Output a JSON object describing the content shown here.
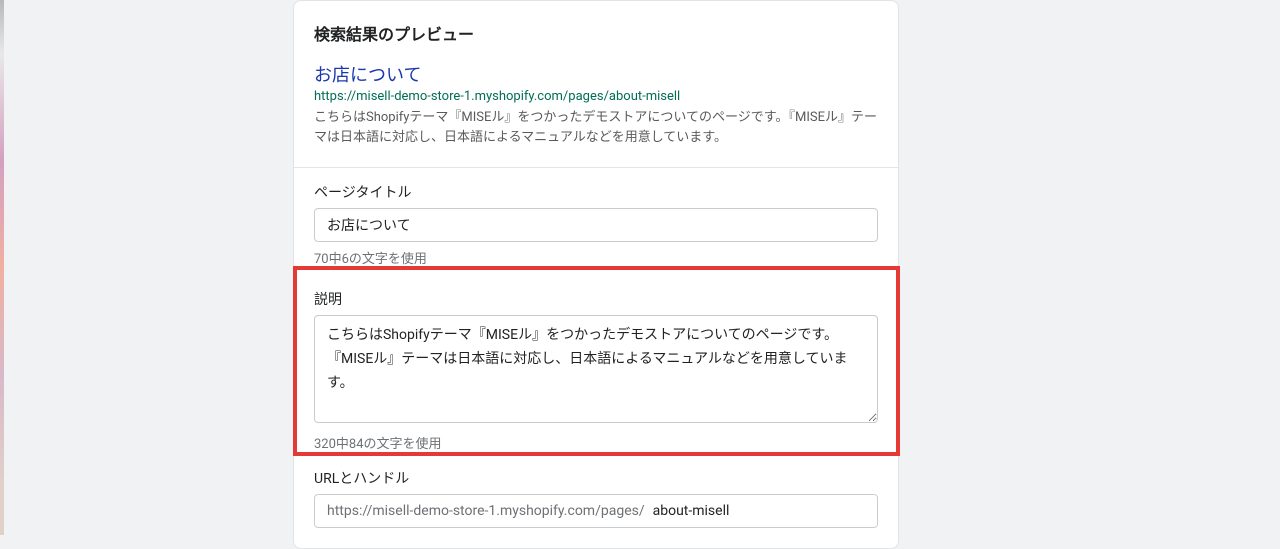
{
  "preview": {
    "section_title": "検索結果のプレビュー",
    "link_text": "お店について",
    "url": "https://misell-demo-store-1.myshopify.com/pages/about-misell",
    "description": "こちらはShopifyテーマ『MISEル』をつかったデモストアについてのページです。『MISEル』テーマは日本語に対応し、日本語によるマニュアルなどを用意しています。"
  },
  "page_title": {
    "label": "ページタイトル",
    "value": "お店について",
    "helper": "70中6の文字を使用"
  },
  "description": {
    "label": "説明",
    "value": "こちらはShopifyテーマ『MISEル』をつかったデモストアについてのページです。『MISEル』テーマは日本語に対応し、日本語によるマニュアルなどを用意しています。",
    "helper": "320中84の文字を使用"
  },
  "url_handle": {
    "label": "URLとハンドル",
    "prefix": "https://misell-demo-store-1.myshopify.com/pages/",
    "value": "about-misell"
  }
}
